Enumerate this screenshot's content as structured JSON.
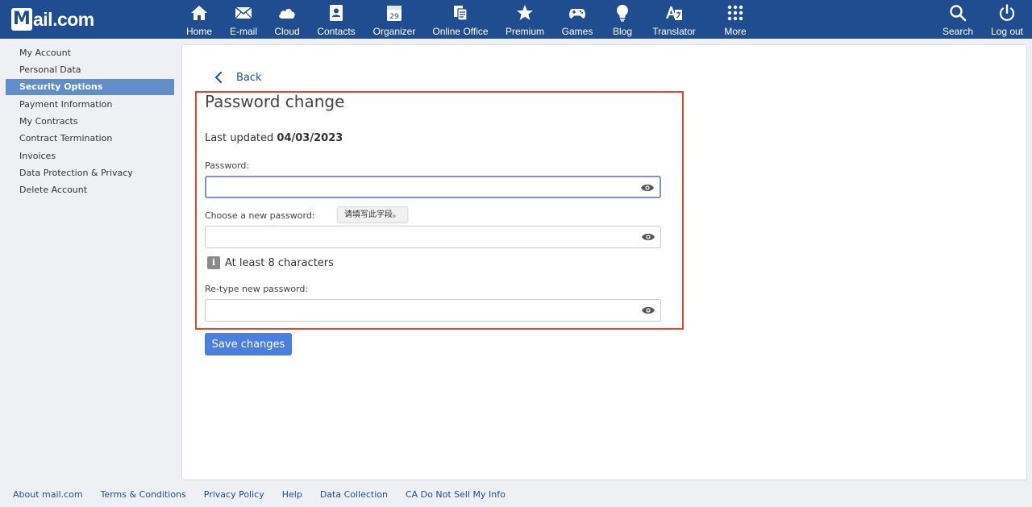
{
  "brand": {
    "logo_text": "ail.com",
    "logo_letter": "M"
  },
  "nav": {
    "items": [
      {
        "label": "Home",
        "icon": "home-icon"
      },
      {
        "label": "E-mail",
        "icon": "mail-icon"
      },
      {
        "label": "Cloud",
        "icon": "cloud-icon"
      },
      {
        "label": "Contacts",
        "icon": "contacts-icon"
      },
      {
        "label": "Organizer",
        "icon": "calendar-icon",
        "icon_text": "29"
      },
      {
        "label": "Online Office",
        "icon": "office-icon"
      },
      {
        "label": "Premium",
        "icon": "star-icon"
      },
      {
        "label": "Games",
        "icon": "gamepad-icon"
      },
      {
        "label": "Blog",
        "icon": "lightbulb-icon"
      },
      {
        "label": "Translator",
        "icon": "translate-icon"
      },
      {
        "label": "More",
        "icon": "grid-icon"
      }
    ],
    "search_label": "Search",
    "logout_label": "Log out"
  },
  "sidebar": {
    "items": [
      {
        "label": "My Account"
      },
      {
        "label": "Personal Data"
      },
      {
        "label": "Security Options",
        "active": true
      },
      {
        "label": "Payment Information"
      },
      {
        "label": "My Contracts"
      },
      {
        "label": "Contract Termination"
      },
      {
        "label": "Invoices"
      },
      {
        "label": "Data Protection & Privacy"
      },
      {
        "label": "Delete Account"
      }
    ]
  },
  "main": {
    "back_label": "Back",
    "title": "Password change",
    "last_updated_prefix": "Last updated",
    "last_updated_date": "04/03/2023",
    "fields": {
      "password_label": "Password:",
      "new_password_label": "Choose a new password:",
      "retype_label": "Re-type new password:"
    },
    "tooltip": "请填写此字段。",
    "hint": "At least 8 characters",
    "save_label": "Save changes"
  },
  "footer": {
    "links": [
      "About mail.com",
      "Terms & Conditions",
      "Privacy Policy",
      "Help",
      "Data Collection",
      "CA Do Not Sell My Info"
    ]
  },
  "colors": {
    "brand": "#1f4d8f",
    "active_sidebar": "#5f8ec9",
    "button": "#4a7fe0",
    "highlight": "#e0492f"
  }
}
